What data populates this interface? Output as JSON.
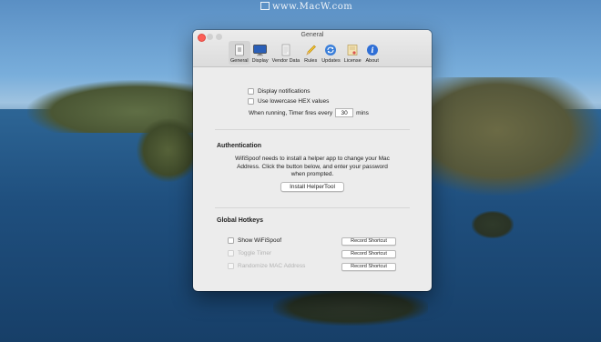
{
  "watermark": "www.MacW.com",
  "window": {
    "title": "General",
    "toolbar": [
      {
        "label": "General",
        "icon": "general-icon",
        "active": true
      },
      {
        "label": "Display",
        "icon": "display-icon"
      },
      {
        "label": "Vendor Data",
        "icon": "vendor-data-icon"
      },
      {
        "label": "Rules",
        "icon": "rules-icon"
      },
      {
        "label": "Updates",
        "icon": "updates-icon"
      },
      {
        "label": "License",
        "icon": "license-icon"
      },
      {
        "label": "About",
        "icon": "about-icon"
      }
    ]
  },
  "general": {
    "display_notifications": "Display notifications",
    "use_lowercase_hex": "Use lowercase HEX values",
    "timer_prefix": "When running, Timer fires every",
    "timer_value": "30",
    "timer_suffix": "mins"
  },
  "authentication": {
    "title": "Authentication",
    "line1": "WifiSpoof needs to install a helper app to change your Mac",
    "line2": "Address. Click the button below, and enter your password",
    "line3": "when prompted.",
    "button": "Install HelperTool"
  },
  "hotkeys": {
    "title": "Global Hotkeys",
    "items": [
      {
        "label": "Show WiFiSpoof",
        "shortcut": "Record Shortcut",
        "enabled": true
      },
      {
        "label": "Toggle Timer",
        "shortcut": "Record Shortcut",
        "enabled": false
      },
      {
        "label": "Randomize MAC Address",
        "shortcut": "Record Shortcut",
        "enabled": false
      }
    ]
  }
}
